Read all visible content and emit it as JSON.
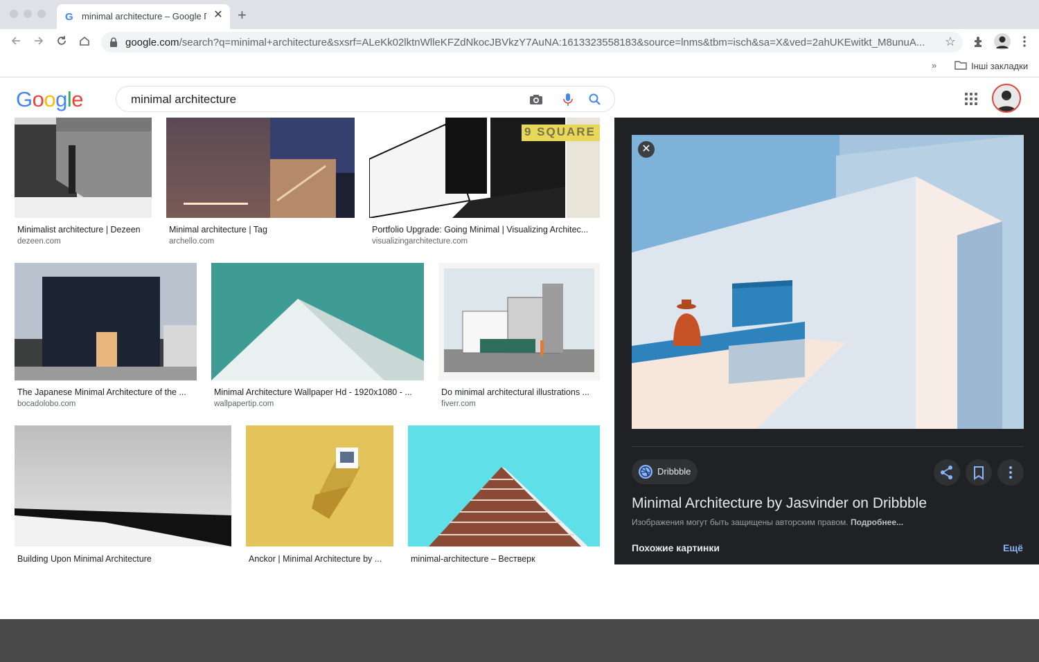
{
  "browser": {
    "tab": {
      "favicon": "G",
      "title": "minimal architecture – Google Пошук",
      "close_glyph": "✕"
    },
    "new_tab_glyph": "+",
    "address": {
      "host": "google.com",
      "path": "/search?q=minimal+architecture&sxsrf=ALeKk02lktnWlleKFZdNkocJBVkzY7AuNA:1613323558183&source=lnms&tbm=isch&sa=X&ved=2ahUKEwitkt_M8unuA..."
    },
    "bookmarks": {
      "chevron": "»",
      "folder_label": "Інші закладки"
    },
    "icons": [
      "back-icon",
      "forward-icon",
      "reload-icon",
      "home-icon",
      "lock-icon",
      "star-icon",
      "extensions-icon",
      "profile-icon",
      "menu-icon"
    ]
  },
  "google": {
    "logo": [
      "G",
      "o",
      "o",
      "g",
      "l",
      "e"
    ],
    "logo_colors": [
      "#4285f4",
      "#ea4335",
      "#fbbc05",
      "#4285f4",
      "#34a853",
      "#ea4335"
    ],
    "query": "minimal architecture"
  },
  "results": [
    {
      "title": "Minimalist architecture | Dezeen",
      "source": "dezeen.com"
    },
    {
      "title": "Minimal architecture | Tag",
      "source": "archello.com"
    },
    {
      "title": "Portfolio Upgrade: Going Minimal | Visualizing Architec...",
      "source": "visualizingarchitecture.com",
      "overlay_text": "9 SQUARE"
    },
    {
      "title": "The Japanese Minimal Architecture of the ...",
      "source": "bocadolobo.com"
    },
    {
      "title": "Minimal Architecture Wallpaper Hd - 1920x1080 - ...",
      "source": "wallpapertip.com"
    },
    {
      "title": "Do minimal architectural illustrations ...",
      "source": "fiverr.com"
    },
    {
      "title": "Building Upon Minimal Architecture",
      "source": ""
    },
    {
      "title": "Anckor | Minimal Architecture by ...",
      "source": ""
    },
    {
      "title": "minimal-architecture – Вестверк",
      "source": ""
    }
  ],
  "panel": {
    "close_glyph": "✕",
    "site_chip": "Dribbble",
    "title": "Minimal Architecture by Jasvinder on Dribbble",
    "copyright": "Изображения могут быть защищены авторским правом.",
    "learn_more": "Подробнее...",
    "similar_heading": "Похожие картинки",
    "more_link": "Ещё"
  },
  "colors": {
    "panel_bg": "#202124",
    "link_blue": "#8ab4f8",
    "tabstrip": "#dee1e6"
  }
}
